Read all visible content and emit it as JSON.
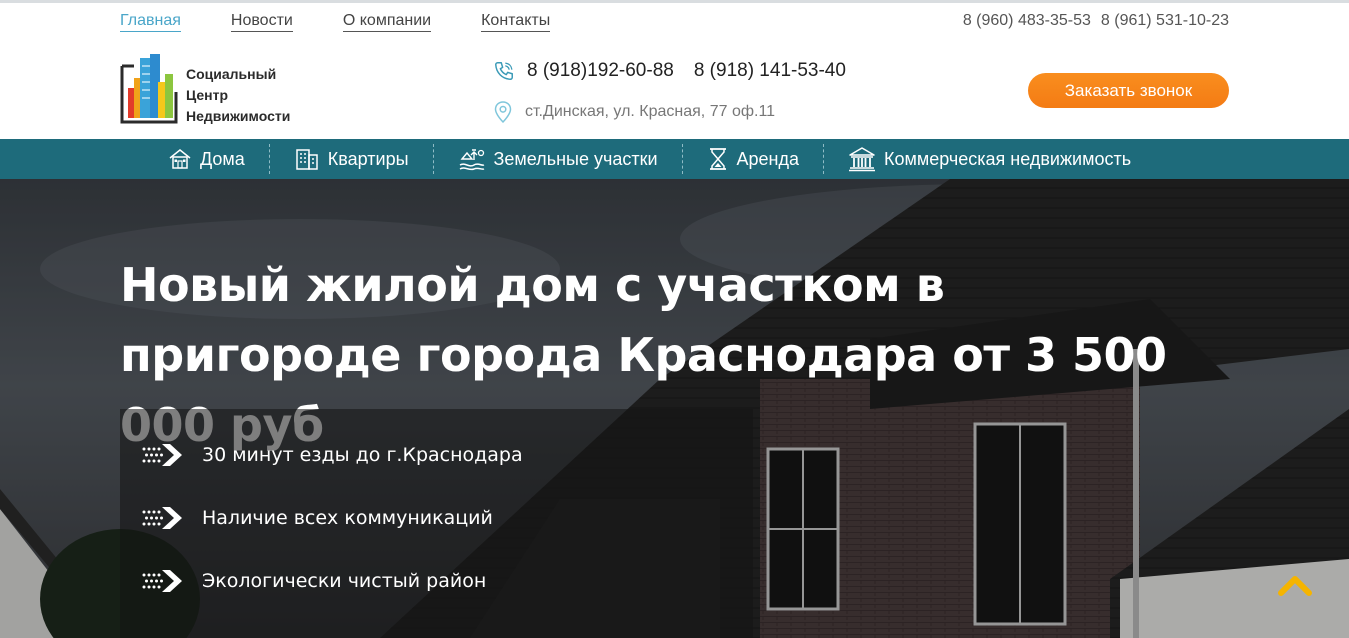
{
  "topnav": {
    "items": [
      {
        "label": "Главная",
        "active": true
      },
      {
        "label": "Новости"
      },
      {
        "label": "О компании"
      },
      {
        "label": "Контакты"
      }
    ],
    "phones": [
      "8 (960) 483-35-53",
      "8 (961) 531-10-23"
    ]
  },
  "logo": {
    "lines": [
      "Социальный",
      "Центр",
      "Недвижимости"
    ]
  },
  "contacts": {
    "phones": [
      "8 (918)192-60-88",
      "8 (918) 141-53-40"
    ],
    "address": "ст.Динская, ул. Красная, 77 оф.11",
    "phone_icon": "phone-icon",
    "address_icon": "map-pin-icon"
  },
  "callback_button": "Заказать звонок",
  "categories": [
    {
      "label": "Дома",
      "icon": "house-icon"
    },
    {
      "label": "Квартиры",
      "icon": "apartment-building-icon"
    },
    {
      "label": "Земельные участки",
      "icon": "land-plot-icon"
    },
    {
      "label": "Аренда",
      "icon": "hourglass-icon"
    },
    {
      "label": "Коммерческая недвижимость",
      "icon": "bank-building-icon"
    }
  ],
  "hero": {
    "headline": "Новый жилой дом с участком в пригороде города Краснодара от 3 500 000 руб",
    "features": [
      "30 минут езды до г.Краснодара",
      "Наличие всех коммуникаций",
      "Экологически чистый район"
    ]
  },
  "colors": {
    "accent": "#f47b14",
    "nav_bar": "#1e6b7b",
    "link_active": "#4aa6c9",
    "scroll_top": "#f5b400"
  }
}
